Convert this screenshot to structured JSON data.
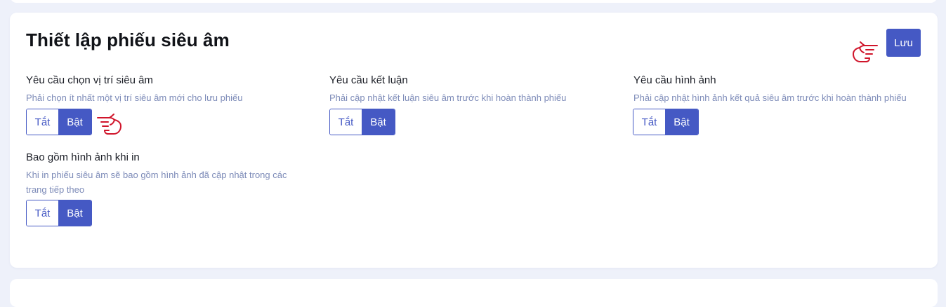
{
  "page": {
    "title": "Thiết lập phiếu siêu âm",
    "save_label": "Lưu"
  },
  "colors": {
    "accent": "#4559c4",
    "hint": "#7d8bb8",
    "pointer": "#d0152b"
  },
  "settings": [
    {
      "title": "Yêu cầu chọn vị trí siêu âm",
      "description": "Phải chọn ít nhất một vị trí siêu âm mới cho lưu phiếu",
      "off_label": "Tắt",
      "on_label": "Bật",
      "value": "on"
    },
    {
      "title": "Yêu cầu kết luận",
      "description": "Phải cập nhật kết luận siêu âm trước khi hoàn thành phiếu",
      "off_label": "Tắt",
      "on_label": "Bật",
      "value": "on"
    },
    {
      "title": "Yêu cầu hình ảnh",
      "description": "Phải cập nhật hình ảnh kết quả siêu âm trước khi hoàn thành phiếu",
      "off_label": "Tắt",
      "on_label": "Bật",
      "value": "on"
    },
    {
      "title": "Bao gồm hình ảnh khi in",
      "description_line1": "Khi in phiếu siêu âm sẽ bao gồm hình ảnh đã cập nhật trong các",
      "description_line2": "trang tiếp theo",
      "off_label": "Tắt",
      "on_label": "Bật",
      "value": "on"
    }
  ],
  "annotations": [
    {
      "icon": "pointing-hand-icon",
      "points_to": "toggle-on"
    },
    {
      "icon": "pointing-hand-icon",
      "points_to": "save-button"
    }
  ]
}
